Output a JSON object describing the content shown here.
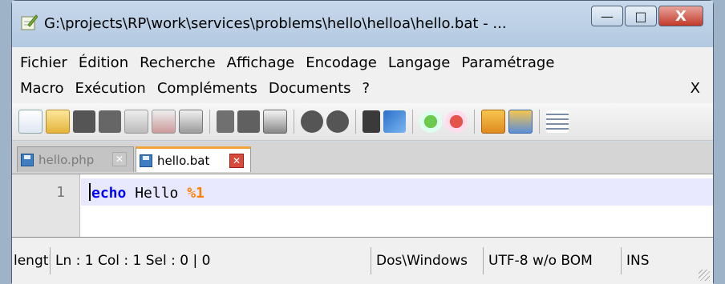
{
  "window": {
    "title": "G:\\projects\\RP\\work\\services\\problems\\hello\\helloa\\hello.bat - ...",
    "buttons": {
      "minimize": "—",
      "maximize": "□",
      "close": "X"
    }
  },
  "menu": {
    "row1": [
      "Fichier",
      "Édition",
      "Recherche",
      "Affichage",
      "Encodage",
      "Langage",
      "Paramétrage"
    ],
    "row2": [
      "Macro",
      "Exécution",
      "Compléments",
      "Documents",
      "?"
    ],
    "close_label": "X"
  },
  "toolbar": {
    "icons": [
      "new-file-icon",
      "open-file-icon",
      "save-icon",
      "save-all-icon",
      "close-icon",
      "close-all-icon",
      "print-icon",
      "cut-icon",
      "copy-icon",
      "paste-icon",
      "undo-icon",
      "redo-icon",
      "find-icon",
      "replace-icon",
      "zoom-in-icon",
      "zoom-out-icon",
      "sync-vertical-icon",
      "sync-horizontal-icon",
      "word-wrap-icon"
    ]
  },
  "tabs": [
    {
      "label": "hello.php",
      "active": false,
      "close": "✕"
    },
    {
      "label": "hello.bat",
      "active": true,
      "close": "✕"
    }
  ],
  "editor": {
    "line_number": "1",
    "code": {
      "keyword": "echo",
      "text": " Hello ",
      "arg": "%1"
    }
  },
  "statusbar": {
    "length": "length",
    "position": "Ln : 1    Col : 1    Sel : 0 | 0",
    "eol": "Dos\\Windows",
    "encoding": "UTF-8 w/o BOM",
    "mode": "INS"
  },
  "colors": {
    "keyword": "#0000ff",
    "argument": "#ff8000",
    "current_line": "#e8e8ff",
    "active_tab_accent": "#f2a33a"
  }
}
